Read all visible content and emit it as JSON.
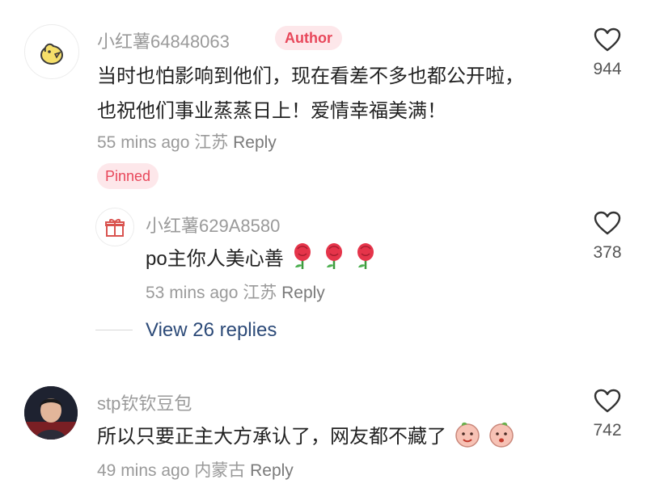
{
  "comments": [
    {
      "username": "小红薯64848063",
      "badge": "Author",
      "text_line1": "当时也怕影响到他们，现在看差不多也都公开啦，",
      "text_line2": "也祝他们事业蒸蒸日上！爱情幸福美满！",
      "time": "55 mins ago",
      "location": "江苏",
      "reply_label": "Reply",
      "likes": "944",
      "avatar_icon": "chick-icon"
    },
    {
      "pinned_label": "Pinned",
      "username": "小红薯629A8580",
      "text": "po主你人美心善",
      "time": "53 mins ago",
      "location": "江苏",
      "reply_label": "Reply",
      "likes": "378",
      "avatar_icon": "gift-icon",
      "emoji": [
        "rose-icon",
        "rose-icon",
        "rose-icon"
      ]
    },
    {
      "username": "stp钦钦豆包",
      "text": "所以只要正主大方承认了，网友都不藏了",
      "time": "49 mins ago",
      "location": "内蒙古",
      "reply_label": "Reply",
      "likes": "742",
      "avatar_icon": "user-photo",
      "emoji": [
        "peach-face-icon",
        "peach-face-icon"
      ]
    }
  ],
  "view_replies": "View 26 replies",
  "colors": {
    "accent": "#e8475a",
    "badge_bg": "#fde7ea",
    "link": "#2c4a78",
    "muted": "#9a9a9a"
  }
}
